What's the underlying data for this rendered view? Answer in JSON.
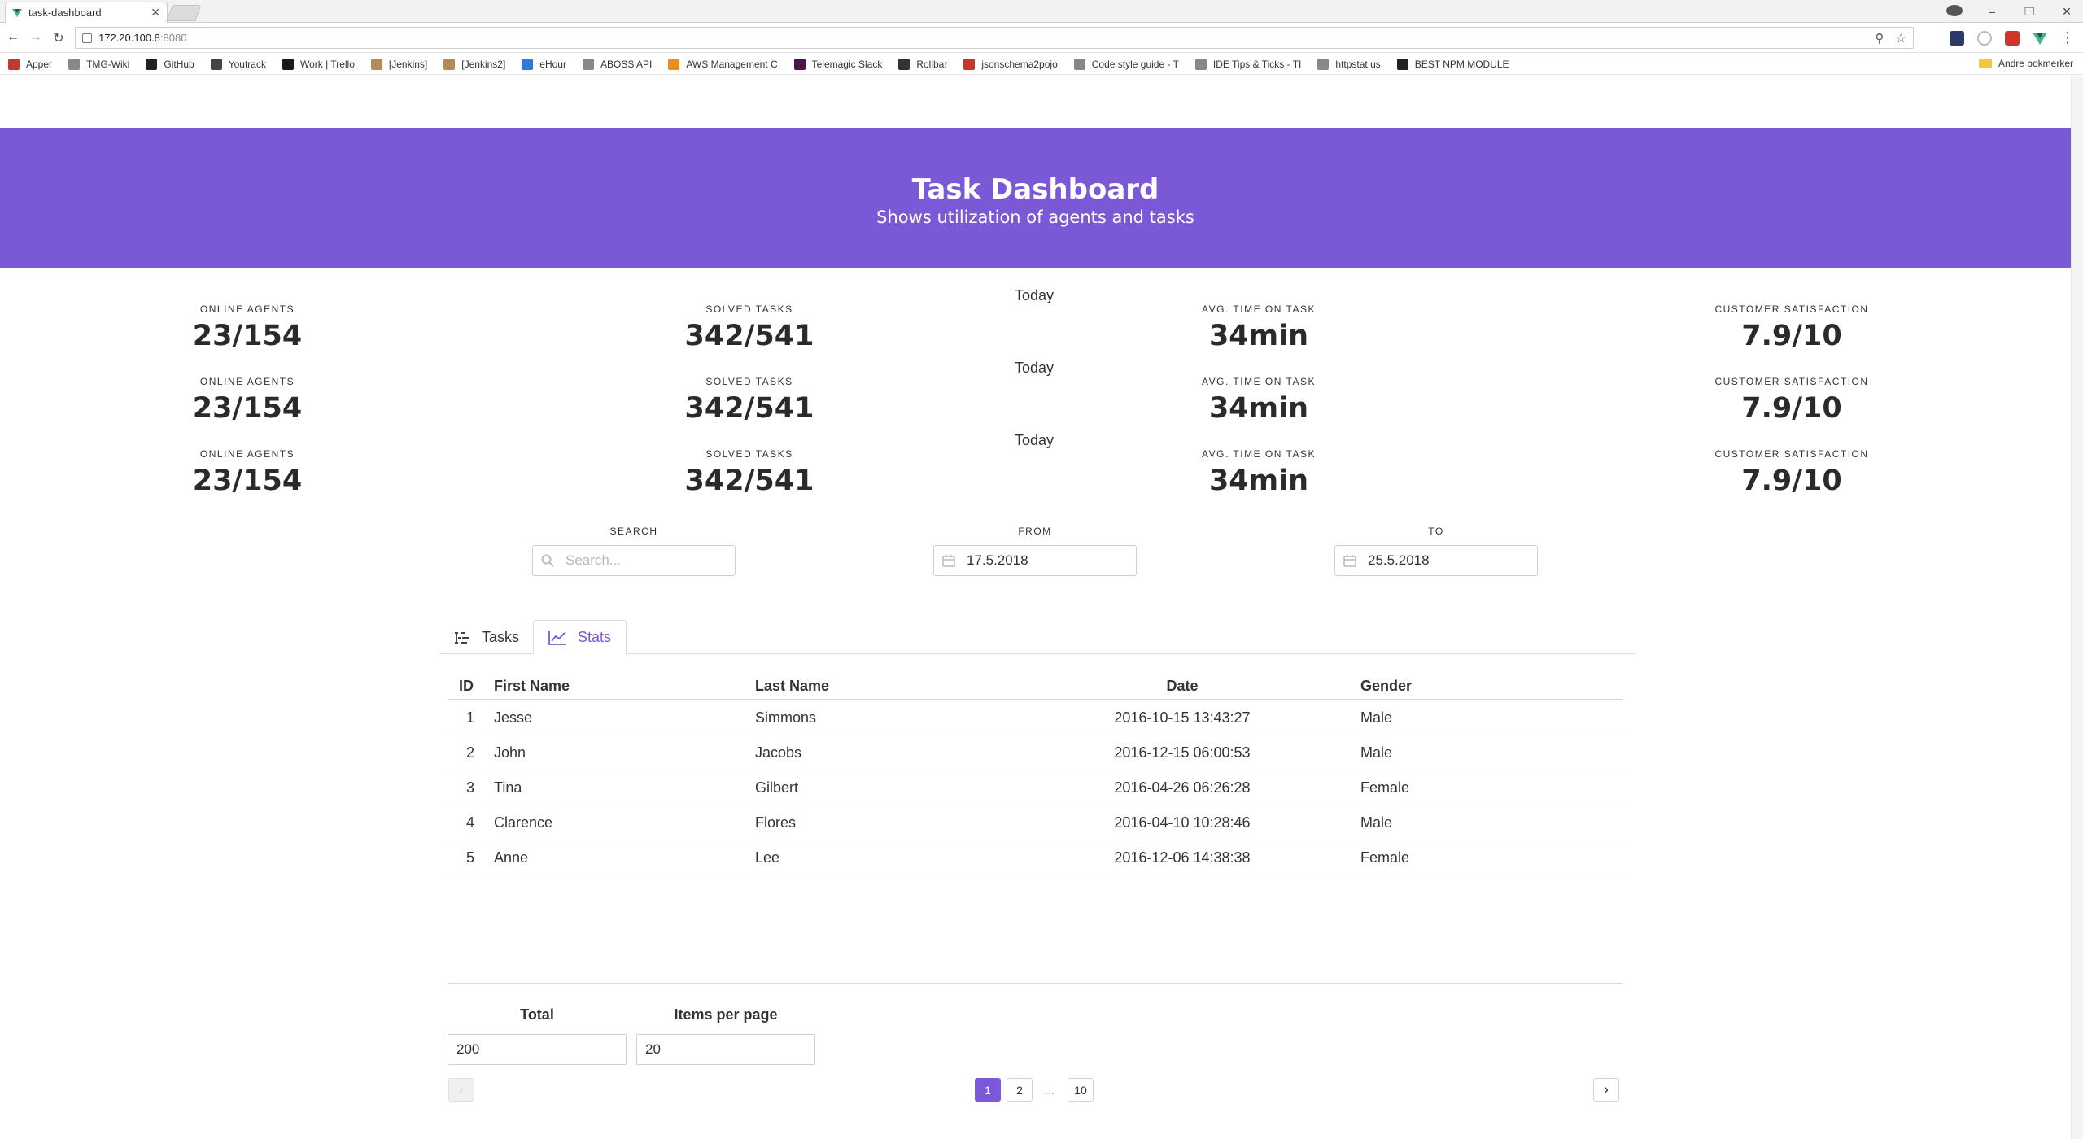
{
  "browser": {
    "tab_title": "task-dashboard",
    "url_host": "172.20.100.8",
    "url_port": ":8080",
    "bookmarks": [
      {
        "label": "Apper",
        "icon": "apps-grid-icon",
        "color": "#c0392b"
      },
      {
        "label": "TMG-Wiki",
        "icon": "page-icon",
        "color": "#888888"
      },
      {
        "label": "GitHub",
        "icon": "github-icon",
        "color": "#222222"
      },
      {
        "label": "Youtrack",
        "icon": "youtrack-icon",
        "color": "#444444"
      },
      {
        "label": "Work | Trello",
        "icon": "trello-icon",
        "color": "#1a1a1a"
      },
      {
        "label": "[Jenkins]",
        "icon": "jenkins-icon",
        "color": "#b88a5a"
      },
      {
        "label": "[Jenkins2]",
        "icon": "jenkins-icon",
        "color": "#b88a5a"
      },
      {
        "label": "eHour",
        "icon": "ehour-icon",
        "color": "#2e7bd6"
      },
      {
        "label": "ABOSS API",
        "icon": "page-icon",
        "color": "#888888"
      },
      {
        "label": "AWS Management C",
        "icon": "aws-icon",
        "color": "#f08c1e"
      },
      {
        "label": "Telemagic Slack",
        "icon": "slack-icon",
        "color": "#4a154b"
      },
      {
        "label": "Rollbar",
        "icon": "rollbar-icon",
        "color": "#333333"
      },
      {
        "label": "jsonschema2pojo",
        "icon": "jsonschema-icon",
        "color": "#c0392b"
      },
      {
        "label": "Code style guide - T",
        "icon": "page-icon",
        "color": "#888888"
      },
      {
        "label": "IDE Tips & Ticks - TI",
        "icon": "page-icon",
        "color": "#888888"
      },
      {
        "label": "httpstat.us",
        "icon": "page-icon",
        "color": "#888888"
      },
      {
        "label": "BEST NPM MODULE",
        "icon": "c-icon",
        "color": "#222222"
      }
    ],
    "bookmarks_folder": "Andre bokmerker"
  },
  "hero": {
    "title": "Task Dashboard",
    "subtitle": "Shows utilization of agents and tasks",
    "color": "#7b58d6"
  },
  "stats_rows": [
    {
      "period": "Today",
      "items": [
        {
          "label": "ONLINE AGENTS",
          "value": "23/154"
        },
        {
          "label": "SOLVED TASKS",
          "value": "342/541"
        },
        {
          "label": "AVG. TIME ON TASK",
          "value": "34min"
        },
        {
          "label": "CUSTOMER SATISFACTION",
          "value": "7.9/10"
        }
      ]
    },
    {
      "period": "Today",
      "items": [
        {
          "label": "ONLINE AGENTS",
          "value": "23/154"
        },
        {
          "label": "SOLVED TASKS",
          "value": "342/541"
        },
        {
          "label": "AVG. TIME ON TASK",
          "value": "34min"
        },
        {
          "label": "CUSTOMER SATISFACTION",
          "value": "7.9/10"
        }
      ]
    },
    {
      "period": "Today",
      "items": [
        {
          "label": "ONLINE AGENTS",
          "value": "23/154"
        },
        {
          "label": "SOLVED TASKS",
          "value": "342/541"
        },
        {
          "label": "AVG. TIME ON TASK",
          "value": "34min"
        },
        {
          "label": "CUSTOMER SATISFACTION",
          "value": "7.9/10"
        }
      ]
    }
  ],
  "filters": {
    "search": {
      "label": "SEARCH",
      "placeholder": "Search...",
      "value": ""
    },
    "from": {
      "label": "FROM",
      "value": "17.5.2018"
    },
    "to": {
      "label": "TO",
      "value": "25.5.2018"
    }
  },
  "tabs": [
    {
      "label": "Tasks",
      "icon": "tree-list-icon",
      "active": false
    },
    {
      "label": "Stats",
      "icon": "line-chart-icon",
      "active": true
    }
  ],
  "table": {
    "headers": [
      "ID",
      "First Name",
      "Last Name",
      "Date",
      "Gender"
    ],
    "rows": [
      {
        "id": "1",
        "first": "Jesse",
        "last": "Simmons",
        "date": "2016-10-15 13:43:27",
        "gender": "Male"
      },
      {
        "id": "2",
        "first": "John",
        "last": "Jacobs",
        "date": "2016-12-15 06:00:53",
        "gender": "Male"
      },
      {
        "id": "3",
        "first": "Tina",
        "last": "Gilbert",
        "date": "2016-04-26 06:26:28",
        "gender": "Female"
      },
      {
        "id": "4",
        "first": "Clarence",
        "last": "Flores",
        "date": "2016-04-10 10:28:46",
        "gender": "Male"
      },
      {
        "id": "5",
        "first": "Anne",
        "last": "Lee",
        "date": "2016-12-06 14:38:38",
        "gender": "Female"
      }
    ]
  },
  "pagination": {
    "total_label": "Total",
    "total_value": "200",
    "per_page_label": "Items per page",
    "per_page_value": "20",
    "pages": [
      "1",
      "2",
      "10"
    ],
    "current_page": "1",
    "ellipsis": "..."
  }
}
